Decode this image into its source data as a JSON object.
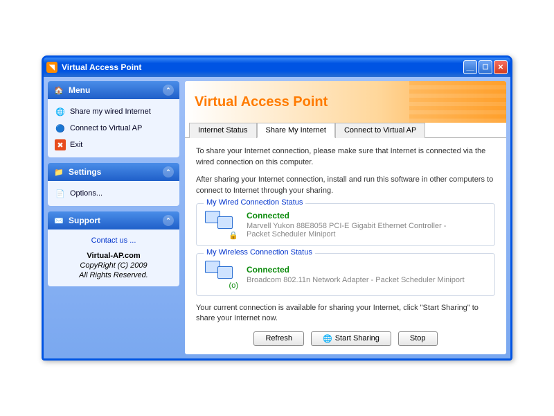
{
  "window": {
    "title": "Virtual Access Point"
  },
  "sidebar": {
    "menu": {
      "title": "Menu",
      "items": [
        {
          "label": "Share my wired Internet",
          "icon": "🌐"
        },
        {
          "label": "Connect to Virtual AP",
          "icon": "🔵"
        },
        {
          "label": "Exit",
          "icon": "✖"
        }
      ]
    },
    "settings": {
      "title": "Settings",
      "items": [
        {
          "label": "Options...",
          "icon": "📄"
        }
      ]
    },
    "support": {
      "title": "Support",
      "contact": "Contact us ...",
      "site": "Virtual-AP.com",
      "copyright": "CopyRight (C) 2009",
      "rights": "All Rights Reserved."
    }
  },
  "main": {
    "heading": "Virtual Access Point",
    "tabs": [
      {
        "label": "Internet Status"
      },
      {
        "label": "Share My Internet"
      },
      {
        "label": "Connect to Virtual AP"
      }
    ],
    "intro1": "To share your Internet connection, please make sure that Internet is connected via the wired connection on this computer.",
    "intro2": "After sharing your Internet connection, install and run this software in other computers to connect to Internet through your sharing.",
    "wired": {
      "title": "My Wired Connection Status",
      "status": "Connected",
      "desc": "Marvell Yukon 88E8058 PCI-E Gigabit Ethernet Controller - Packet Scheduler Miniport"
    },
    "wireless": {
      "title": "My Wireless Connection Status",
      "status": "Connected",
      "desc": "Broadcom 802.11n Network Adapter - Packet Scheduler Miniport"
    },
    "footnote": "Your current connection is available for sharing your Internet, click \"Start Sharing\" to share your Internet now.",
    "buttons": {
      "refresh": "Refresh",
      "start": "Start Sharing",
      "stop": "Stop"
    }
  }
}
